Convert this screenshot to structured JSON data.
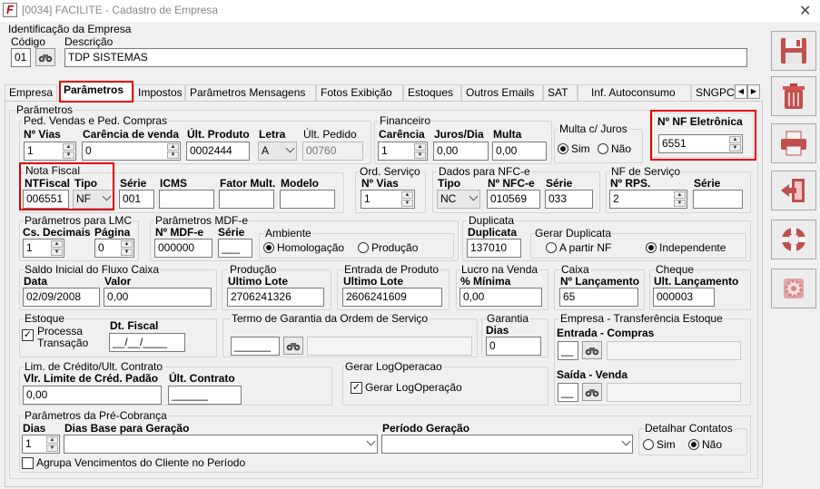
{
  "window": {
    "title": "[0034] FACILITE - Cadastro de Empresa",
    "close": "✕"
  },
  "ident": {
    "legend": "Identificação da Empresa",
    "codigo_label": "Código",
    "codigo": "01",
    "descricao_label": "Descrição",
    "descricao": "TDP SISTEMAS"
  },
  "tabs": [
    "Empresa",
    "Parâmetros",
    "Impostos",
    "Parâmetros Mensagens",
    "Fotos Exibição",
    "Estoques",
    "Outros Emails",
    "SAT",
    "Inf. Autoconsumo",
    "SNGPC"
  ],
  "params": {
    "legend": "Parâmetros"
  },
  "ped": {
    "legend": "Ped. Vendas e Ped. Compras",
    "vias_label": "Nº Vias",
    "vias": "1",
    "carencia_label": "Carência de venda",
    "carencia": "0",
    "ult_produto_label": "Últ. Produto",
    "ult_produto": "0002444",
    "letra_label": "Letra",
    "letra": "A",
    "ult_pedido_label": "Últ. Pedido",
    "ult_pedido": "00760"
  },
  "fin": {
    "legend": "Financeiro",
    "carencia_label": "Carência",
    "carencia": "1",
    "juros_label": "Juros/Dia",
    "juros": "0,00",
    "multa_label": "Multa",
    "multa": "0,00"
  },
  "multa_juros": {
    "legend": "Multa c/ Juros",
    "sim": "Sim",
    "nao": "Não"
  },
  "nfe": {
    "label": "Nº NF Eletrônica",
    "value": "6551"
  },
  "nota": {
    "legend": "Nota Fiscal",
    "ntfiscal_label": "NTFiscal",
    "ntfiscal": "006551",
    "tipo_label": "Tipo",
    "tipo": "NF",
    "serie_label": "Série",
    "serie": "001",
    "icms_label": "ICMS",
    "fator_label": "Fator Mult.",
    "modelo_label": "Modelo"
  },
  "os": {
    "legend": "Ord. Serviço",
    "vias_label": "Nº Vias",
    "vias": "1"
  },
  "nfce": {
    "legend": "Dados para NFC-e",
    "tipo_label": "Tipo",
    "tipo": "NC",
    "num_label": "Nº NFC-e",
    "num": "010569",
    "serie_label": "Série",
    "serie": "033"
  },
  "nfs": {
    "legend": "NF de Serviço",
    "rps_label": "Nº RPS.",
    "rps": "2",
    "serie_label": "Série"
  },
  "lmc": {
    "legend": "Parâmetros para LMC",
    "dec_label": "Cs. Decimais",
    "dec": "1",
    "pag_label": "Página",
    "pag": "0"
  },
  "mdfe": {
    "legend": "Parâmetros MDF-e",
    "num_label": "Nº MDF-e",
    "num": "000000",
    "serie_label": "Série",
    "serie": "___",
    "amb_legend": "Ambiente",
    "homolog": "Homologação",
    "producao": "Produção"
  },
  "dup": {
    "legend": "Duplicata",
    "dup_label": "Duplicata",
    "dup": "137010",
    "gerar_legend": "Gerar Duplicata",
    "a_partir": "A partir NF",
    "indep": "Independente"
  },
  "saldo": {
    "legend": "Saldo Inicial do Fluxo Caixa",
    "data_label": "Data",
    "data": "02/09/2008",
    "valor_label": "Valor",
    "valor": "0,00"
  },
  "prod": {
    "legend": "Produção",
    "lote_label": "Ultimo Lote",
    "lote": "2706241326"
  },
  "entrada": {
    "legend": "Entrada de Produto",
    "lote_label": "Ultimo Lote",
    "lote": "2606241609"
  },
  "lucro": {
    "legend": "Lucro na Venda",
    "min_label": "% Mínima",
    "min": "0,00"
  },
  "caixa": {
    "legend": "Caixa",
    "lanc_label": "Nº Lançamento",
    "lanc": "65"
  },
  "cheque": {
    "legend": "Cheque",
    "lanc_label": "Ult. Lançamento",
    "lanc": "000003"
  },
  "estoque": {
    "legend": "Estoque",
    "processa": "Processa",
    "transacao": "Transação",
    "dt_label": "Dt. Fiscal",
    "dt": "__/__/____"
  },
  "garantia_os": {
    "legend": "Termo de Garantia da Ordem de Serviço",
    "value": "______"
  },
  "garantia": {
    "legend": "Garantia",
    "dias_label": "Dias",
    "dias": "0"
  },
  "transf": {
    "legend": "Empresa - Transferência Estoque",
    "entrada_label": "Entrada - Compras",
    "entrada": "__",
    "saida_label": "Saída - Venda",
    "saida": "__"
  },
  "credito": {
    "legend": "Lim. de Crédito/Ult. Contrato",
    "vlr_label": "Vlr. Limite de Créd. Padão",
    "vlr": "0,00",
    "ult_label": "Últ. Contrato",
    "ult": "______"
  },
  "log": {
    "legend": "Gerar LogOperacao",
    "chk": "Gerar LogOperação"
  },
  "precob": {
    "legend": "Parâmetros da Pré-Cobrança",
    "dias_label": "Dias",
    "dias": "1",
    "base_label": "Dias Base para Geração",
    "periodo_label": "Período Geração",
    "detalhar_legend": "Detalhar Contatos",
    "sim": "Sim",
    "nao": "Não",
    "agrupa": "Agrupa Vencimentos do Cliente no Período"
  },
  "toolbar": [
    "save-icon",
    "trash-icon",
    "print-icon",
    "exit-icon",
    "help-lifebuoy-icon",
    "settings-gear-icon"
  ]
}
